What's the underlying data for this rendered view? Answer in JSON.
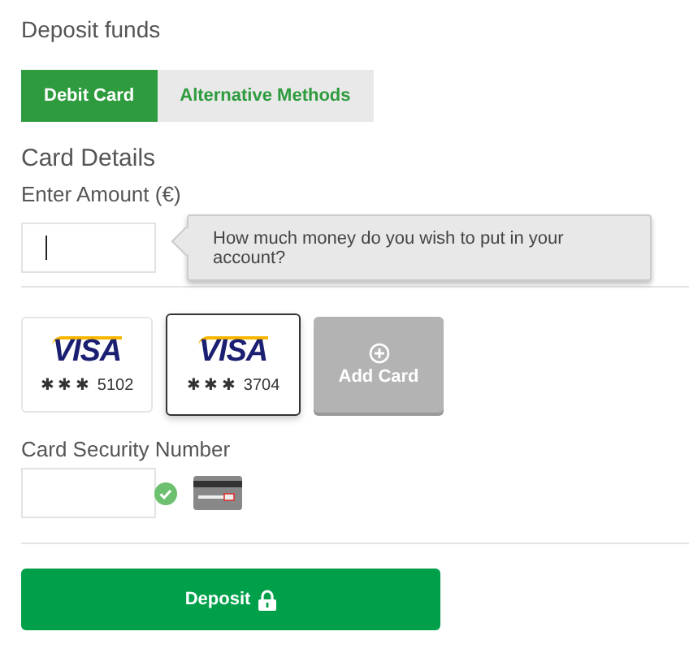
{
  "title": "Deposit funds",
  "tabs": [
    {
      "label": "Debit Card",
      "selected": true
    },
    {
      "label": "Alternative Methods",
      "selected": false
    }
  ],
  "card_details": {
    "heading": "Card Details",
    "amount_label": "Enter Amount (€)",
    "amount_focused": true,
    "tooltip": "How much money do you wish to put in your account?"
  },
  "cards": [
    {
      "brand": "VISA",
      "number": "✱ ✱ ✱  5102",
      "selected": false
    },
    {
      "brand": "VISA",
      "number": "✱ ✱ ✱  3704",
      "selected": true
    }
  ],
  "add_card": "Add Card",
  "security": {
    "label": "Card Security Number",
    "valid": true
  },
  "deposit_button": "Deposit"
}
